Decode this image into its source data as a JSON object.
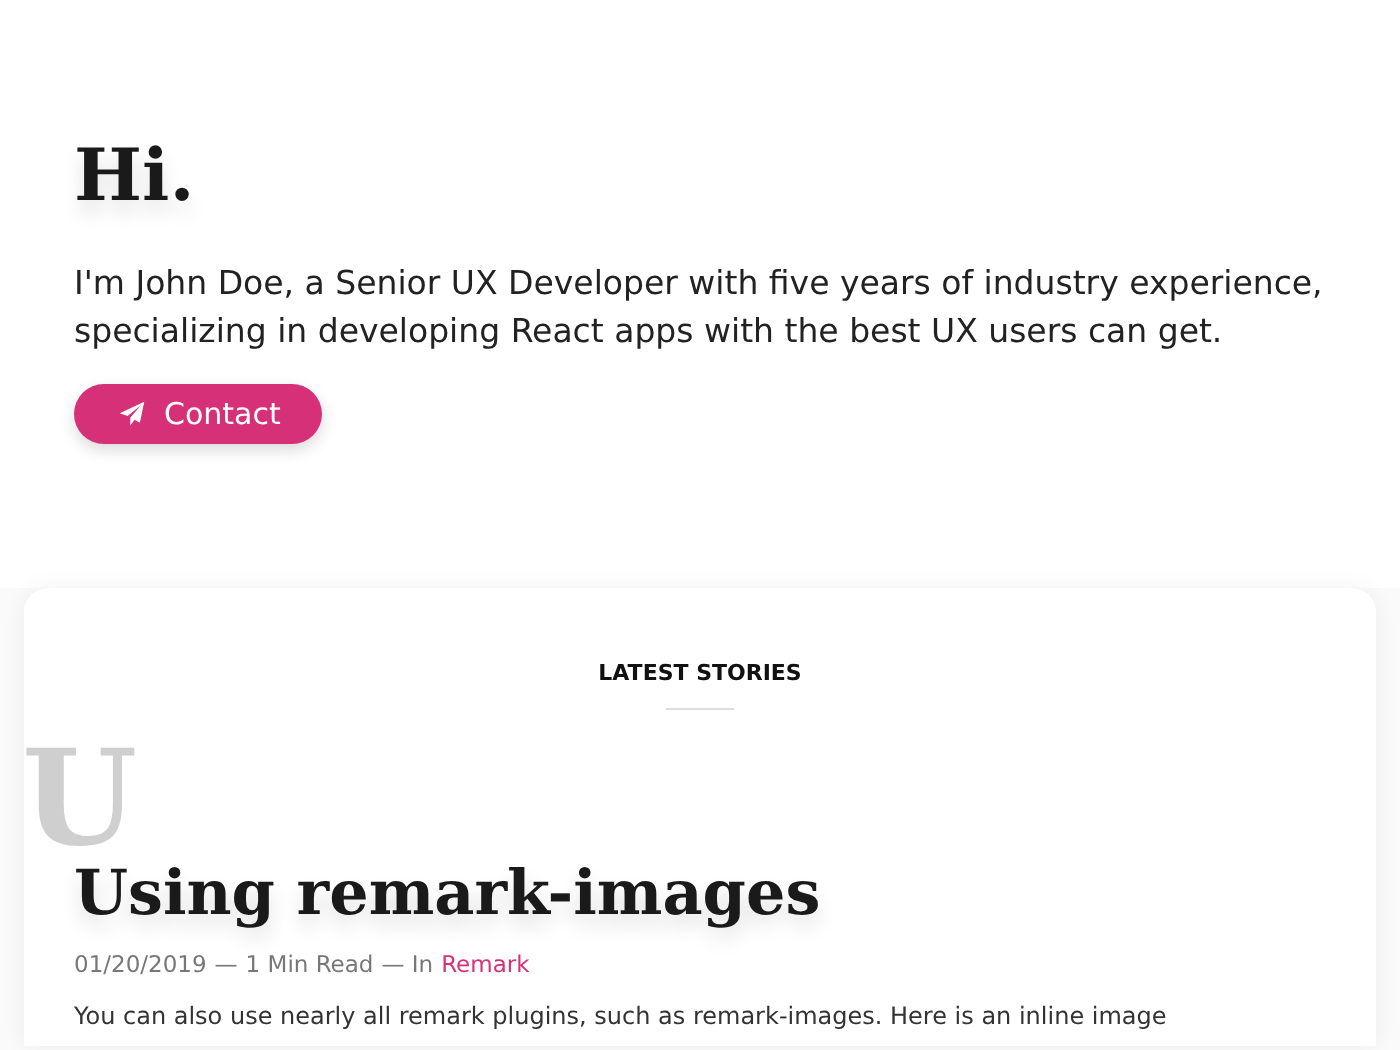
{
  "hero": {
    "heading": "Hi.",
    "intro": "I'm John Doe, a Senior UX Developer with five years of industry experience, specializing in developing React apps with the best UX users can get.",
    "button": {
      "label": "Contact"
    }
  },
  "stories": {
    "heading": "LATEST STORIES",
    "posts": [
      {
        "initial": "U",
        "title": "Using remark-images",
        "date": "01/20/2019",
        "separator_1": "—",
        "read_time": "1 Min Read",
        "separator_2": "— In",
        "category": "Remark",
        "excerpt": "You can also use nearly all remark plugins, such as remark-images. Here is an inline image"
      }
    ]
  }
}
